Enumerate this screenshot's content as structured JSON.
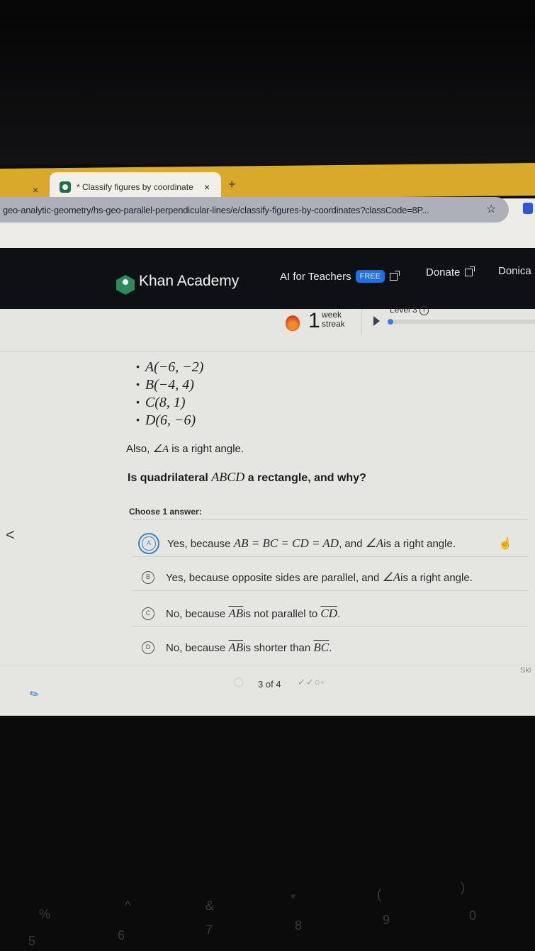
{
  "browser": {
    "prev_tab_close": "×",
    "active_tab": {
      "title": "* Classify figures by coordinate",
      "close": "×"
    },
    "new_tab": "+",
    "url": "geo-analytic-geometry/hs-geo-parallel-perpendicular-lines/e/classify-figures-by-coordinates?classCode=8P...",
    "bookmark_icon": "☆"
  },
  "header": {
    "brand": "Khan Academy",
    "ai_for_teachers": "AI for Teachers",
    "free_badge": "FREE",
    "donate": "Donate",
    "user": "Donica"
  },
  "streak": {
    "count": "1",
    "label_line1": "week",
    "label_line2": "streak",
    "level": "Level 3",
    "info": "i",
    "level_progress_percent": 2
  },
  "problem": {
    "points": [
      "A(−6, −2)",
      "B(−4, 4)",
      "C(8, 1)",
      "D(6, −6)"
    ],
    "also_prefix": "Also, ",
    "also_angle": "∠A",
    "also_suffix": " is a right angle.",
    "question_prefix": "Is quadrilateral ",
    "question_math": "ABCD",
    "question_suffix": " a rectangle, and why?",
    "choose_label": "Choose 1 answer:",
    "choices": [
      {
        "letter": "A",
        "text_pre": "Yes, because ",
        "math": "AB = BC = CD = AD",
        "text_mid": ", and ",
        "math2": "∠A",
        "text_post": " is a right angle.",
        "selected": true
      },
      {
        "letter": "B",
        "text_pre": "Yes, because opposite sides are parallel, and ",
        "math": "∠A",
        "text_post": " is a right angle.",
        "selected": false
      },
      {
        "letter": "C",
        "text_pre": "No, because ",
        "math": "AB",
        "text_mid": " is not parallel to ",
        "math2": "CD",
        "text_post": ".",
        "selected": false
      },
      {
        "letter": "D",
        "text_pre": "No, because ",
        "math": "AB",
        "text_mid": " is shorter than ",
        "math2": "BC",
        "text_post": ".",
        "selected": false
      }
    ]
  },
  "footer": {
    "progress": "3 of 4",
    "marks": "✓✓○◦",
    "skip": "Ski"
  },
  "nav": {
    "back_arrow": "<",
    "scratchpad_icon": "✎"
  },
  "keyboard_glyphs": [
    "%",
    "^",
    "&",
    "*",
    "(",
    ")",
    "5",
    "6",
    "7",
    "8",
    "9",
    "0"
  ]
}
